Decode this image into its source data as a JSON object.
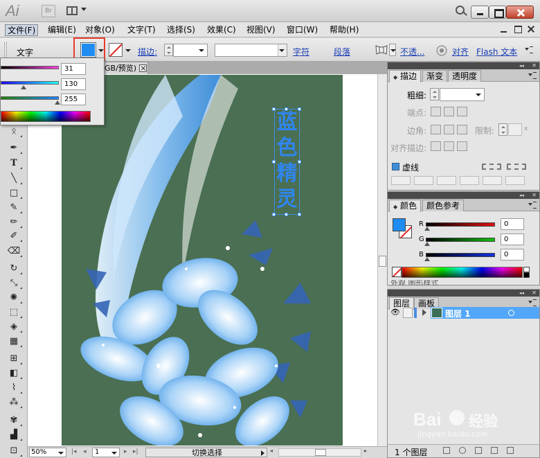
{
  "app": {
    "logo": "Ai",
    "bridge": "Br"
  },
  "menu": [
    "文件(F)",
    "编辑(E)",
    "对象(O)",
    "文字(T)",
    "选择(S)",
    "效果(C)",
    "视图(V)",
    "窗口(W)",
    "帮助(H)"
  ],
  "control_bar": {
    "label": "文字",
    "stroke_label": "描边:",
    "char_link": "字符",
    "para_link": "段落",
    "opacity_link": "不透...",
    "align_link": "对齐",
    "flash_link": "Flash 文本",
    "fill_color": "#1e8cf0"
  },
  "popup_panel": {
    "r": "31",
    "g": "130",
    "b": "255"
  },
  "document": {
    "tab_title": "GB/预览)",
    "zoom": "50%",
    "page": "1",
    "status": "切换选择"
  },
  "artwork": {
    "vertical_text": [
      "蓝",
      "色",
      "精",
      "灵"
    ],
    "background": "#4a6f52",
    "text_color": "#2f86ee"
  },
  "stroke_panel": {
    "tabs": [
      "描边",
      "渐变",
      "透明度"
    ],
    "weight": "粗细:",
    "cap": "端点:",
    "corner": "边角:",
    "limit": "限制:",
    "align": "对齐描边:",
    "dashed": "虚线"
  },
  "color_panel": {
    "tabs": [
      "颜色",
      "颜色参考"
    ],
    "r_label": "R",
    "g_label": "G",
    "b_label": "B",
    "r": "0",
    "g": "0",
    "b": "0",
    "behind_tabs": "外观  图形样式"
  },
  "layers_panel": {
    "tabs": [
      "图层",
      "画板"
    ],
    "layer_name": "图层 1",
    "footer": "1 个图层"
  },
  "watermark": {
    "brand": "Bai",
    "brand_tail": "经验",
    "url": "jingyan.baidu.com"
  }
}
